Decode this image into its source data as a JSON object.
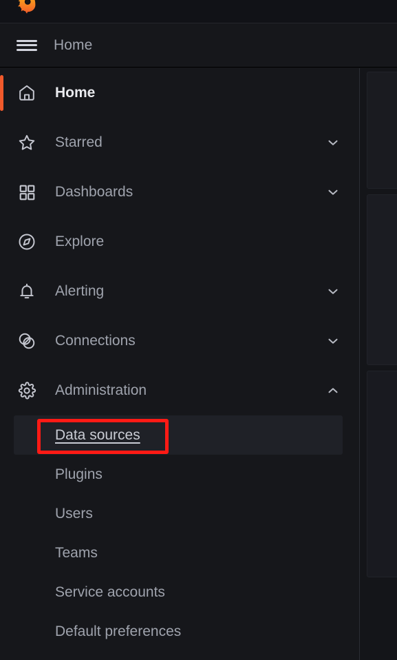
{
  "app": {
    "name": "Grafana",
    "logo_icon": "grafana-logo-icon",
    "accent_color": "#f15a2b",
    "annotation_color": "#ff1a15",
    "background_color": "#16171b"
  },
  "topbar": {
    "menu_toggle_icon": "hamburger-menu-icon",
    "menu_toggle_label": "Toggle menu",
    "breadcrumb": "Home"
  },
  "nav": {
    "items": [
      {
        "label": "Home",
        "icon": "home-icon",
        "active": true,
        "expandable": false,
        "expanded": false
      },
      {
        "label": "Starred",
        "icon": "star-icon",
        "active": false,
        "expandable": true,
        "expanded": false
      },
      {
        "label": "Dashboards",
        "icon": "dashboards-icon",
        "active": false,
        "expandable": true,
        "expanded": false
      },
      {
        "label": "Explore",
        "icon": "compass-icon",
        "active": false,
        "expandable": false,
        "expanded": false
      },
      {
        "label": "Alerting",
        "icon": "bell-icon",
        "active": false,
        "expandable": true,
        "expanded": false
      },
      {
        "label": "Connections",
        "icon": "connections-icon",
        "active": false,
        "expandable": true,
        "expanded": false
      },
      {
        "label": "Administration",
        "icon": "gear-icon",
        "active": false,
        "expandable": true,
        "expanded": true
      }
    ],
    "administration_subitems": [
      {
        "label": "Data sources",
        "highlighted": true
      },
      {
        "label": "Plugins",
        "highlighted": false
      },
      {
        "label": "Users",
        "highlighted": false
      },
      {
        "label": "Teams",
        "highlighted": false
      },
      {
        "label": "Service accounts",
        "highlighted": false
      },
      {
        "label": "Default preferences",
        "highlighted": false
      }
    ]
  },
  "annotation": {
    "target": "Data sources",
    "shape": "rectangle",
    "color": "#ff1a15"
  }
}
